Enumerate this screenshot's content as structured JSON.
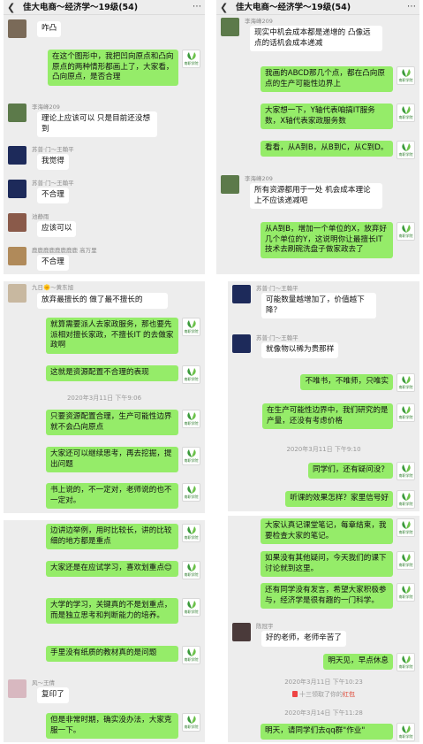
{
  "chat_title": "佳大电商～经济学～19级(54)",
  "back_icon": "chevron-left-icon",
  "more_icon": "more-dots-icon",
  "teacher_logo_text": "南职学院",
  "panel1": [
    {
      "side": "left",
      "name": "",
      "text": "咋凸"
    },
    {
      "side": "right",
      "text": "在这个图形中，我把凹向原点和凸向原点的两种情形都画上了，大家看，凸向原点，是否合理"
    },
    {
      "side": "left",
      "name": "李海峰209",
      "text": "理论上应该可以 只是目前还没想到"
    },
    {
      "side": "left",
      "name": "苏普·门～王翰平",
      "text": "我觉得"
    },
    {
      "side": "left",
      "name": "苏普·门～王翰平",
      "text": "不合理"
    },
    {
      "side": "left",
      "name": "池静雨",
      "text": "应该可以"
    },
    {
      "side": "left",
      "name": "鹿鹿鹿鹿鹿鹿鹿鹿 高万里",
      "text": "不合理"
    }
  ],
  "panel2": [
    {
      "side": "left",
      "name": "李海峰209",
      "text": "现实中机会成本都是递增的 凸像远点的话机会成本递减"
    },
    {
      "side": "right",
      "text": "我画的ABCD那几个点，都在凸向原点的生产可能性边界上"
    },
    {
      "side": "right",
      "text": "大家想一下，Y轴代表咱搞IT服务数，X轴代表家政服务数"
    },
    {
      "side": "right",
      "text": "看看，从A到B，从B到C，从C到D。"
    },
    {
      "side": "left",
      "name": "李海峰209",
      "text": "所有资源都用于一处 机会成本理论上不应该递减吧"
    },
    {
      "side": "right",
      "text": "从A到B，增加一个单位的X，放弃好几个单位的Y，这说明你让最擅长IT技术去刷碗洗盘子做家政去了"
    }
  ],
  "panel3": [
    {
      "side": "left",
      "name": "九日🌞～黄东旭",
      "text": "放弃最擅长的 做了最不擅长的"
    },
    {
      "side": "right",
      "text": "就算需要派人去家政服务，那也要先派相对擅长家政，不擅长IT 的去做家政啊"
    },
    {
      "side": "right",
      "text": "这就是资源配置不合理的表现"
    },
    {
      "type": "time",
      "text": "2020年3月11日 下午9:06"
    },
    {
      "side": "right",
      "text": "只要资源配置合理，生产可能性边界就不会凸向原点"
    },
    {
      "side": "right",
      "text": "大家还可以继续思考，再去挖掘，提出问题"
    },
    {
      "side": "right",
      "text": "书上说的，不一定对，老师说的也不一定对。"
    }
  ],
  "panel4": [
    {
      "side": "left",
      "name": "苏普·门～王翰平",
      "text": "可能数量越增加了，价值越下降？"
    },
    {
      "side": "left",
      "name": "苏普·门～王翰平",
      "text": "就像物以稀为贵那样"
    },
    {
      "side": "right",
      "text": "不唯书，不唯师，只唯实"
    },
    {
      "side": "right",
      "text": "在生产可能性边界中，我们研究的是产量，还没有考虑价格"
    },
    {
      "type": "time",
      "text": "2020年3月11日 下午9:10"
    },
    {
      "side": "right",
      "text": "同学们，还有疑问没？"
    },
    {
      "side": "right",
      "text": "听课的效果怎样？家里信号好"
    }
  ],
  "panel5": [
    {
      "side": "right",
      "text": "边讲边举例，用时比较长，讲的比较细的地方都是重点"
    },
    {
      "side": "right",
      "text": "大家还是在应试学习，喜欢划重点😊"
    },
    {
      "side": "right",
      "text": "大学的学习，关键真的不是划重点，而是独立思考和判断能力的培养。"
    },
    {
      "side": "right",
      "text": "手里没有纸质的教材真的是问题"
    },
    {
      "side": "left",
      "name": "风～王倩",
      "text": "复印了"
    },
    {
      "side": "right",
      "text": "但是非常时期，确实没办法，大家克服一下。"
    }
  ],
  "panel6": [
    {
      "side": "right",
      "text": "大家认真记课堂笔记，每章结束，我要检查大家的笔记。"
    },
    {
      "side": "right",
      "text": "如果没有其他疑问，今天我们的课下讨论就到这里。"
    },
    {
      "side": "right",
      "text": "还有同学没有发言，希望大家积极参与，经济学是很有趣的一门科学。"
    },
    {
      "side": "left",
      "name": "陈冠宇",
      "text": "好的老师，老师辛苦了"
    },
    {
      "side": "right",
      "text": "明天见，早点休息"
    },
    {
      "type": "time",
      "text": "2020年3月11日 下午10:23"
    },
    {
      "type": "sys",
      "text": "十三领取了你的",
      "red": "红包"
    },
    {
      "type": "time",
      "text": "2020年3月14日 下午11:28"
    },
    {
      "side": "right",
      "text": "明天，请同学们去qq群\"作业\""
    }
  ]
}
